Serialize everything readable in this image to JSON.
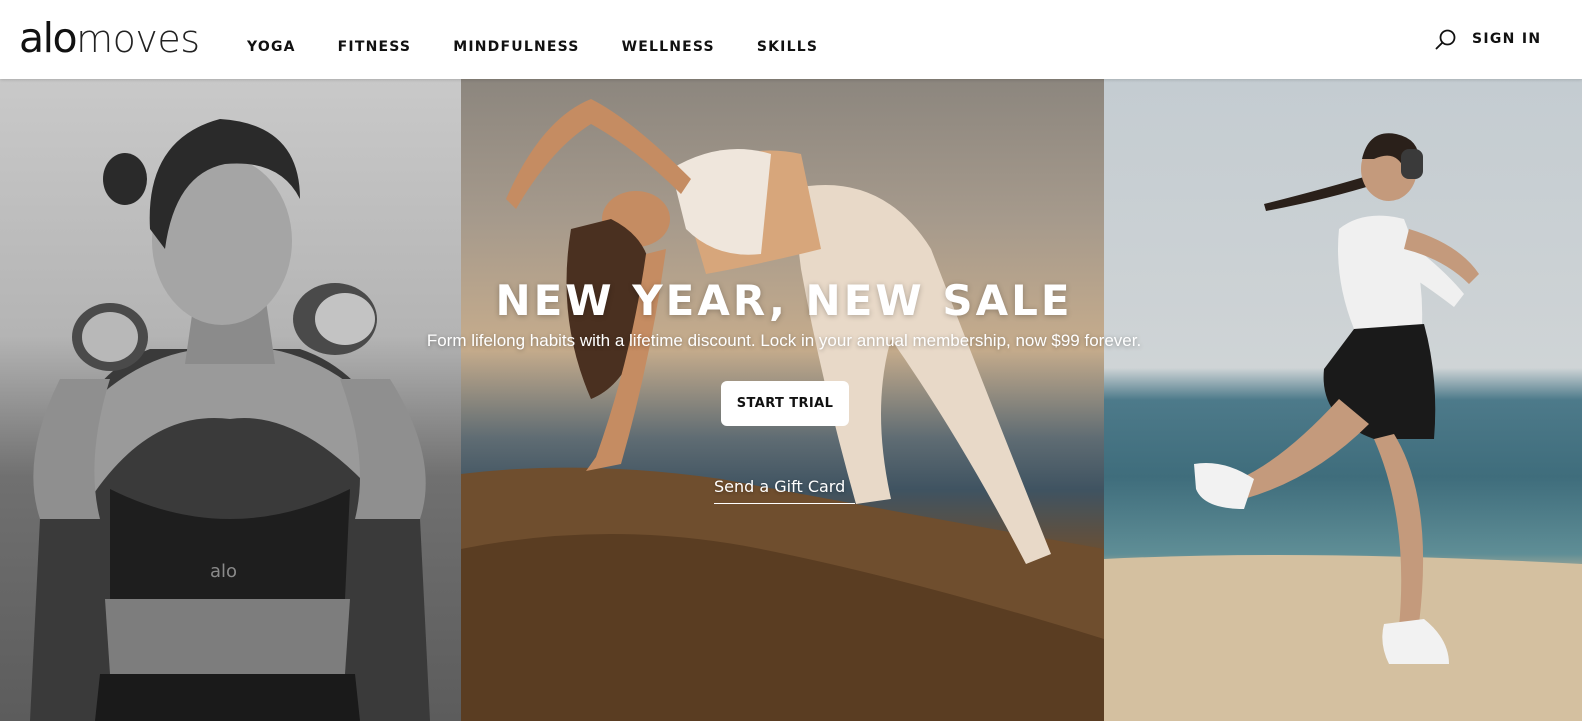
{
  "header": {
    "logo": {
      "strong": "alo",
      "light": "moves"
    },
    "nav": [
      {
        "label": "YOGA"
      },
      {
        "label": "FITNESS"
      },
      {
        "label": "MINDFULNESS"
      },
      {
        "label": "WELLNESS"
      },
      {
        "label": "SKILLS"
      }
    ],
    "search_icon": "search-icon",
    "signin_label": "SIGN IN"
  },
  "hero": {
    "title": "NEW YEAR, NEW SALE",
    "subtitle": "Form lifelong habits with a lifetime discount. Lock in your annual membership, now $99 forever.",
    "cta_label": "START TRIAL",
    "gift_label": "Send a Gift Card",
    "panels": [
      {
        "description_icon": "photo-woman-dumbbells",
        "tone": "#8a8a8a"
      },
      {
        "description_icon": "photo-woman-backbend",
        "tone": "#a07a55"
      },
      {
        "description_icon": "photo-woman-running-beach",
        "tone": "#4f7e8d"
      }
    ],
    "logo_mark_text": "alo"
  },
  "colors": {
    "header_bg": "#ffffff",
    "text_dark": "#111111",
    "cta_bg": "#ffffff",
    "hero_text": "#ffffff"
  }
}
